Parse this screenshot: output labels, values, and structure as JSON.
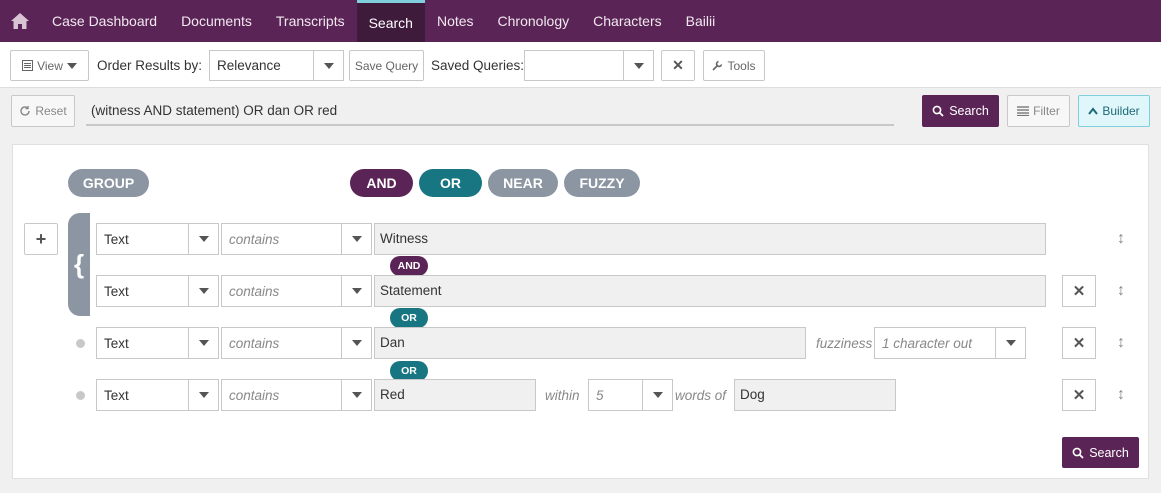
{
  "nav": {
    "home_icon": "home-icon",
    "items": [
      {
        "label": "Case Dashboard"
      },
      {
        "label": "Documents"
      },
      {
        "label": "Transcripts"
      },
      {
        "label": "Search",
        "active": true
      },
      {
        "label": "Notes"
      },
      {
        "label": "Chronology"
      },
      {
        "label": "Characters"
      },
      {
        "label": "Bailii"
      }
    ]
  },
  "toolbar": {
    "view_label": "View",
    "order_label": "Order Results by:",
    "order_value": "Relevance",
    "save_query_label": "Save Query",
    "saved_queries_label": "Saved Queries:",
    "saved_queries_value": "",
    "tools_label": "Tools"
  },
  "search": {
    "reset_label": "Reset",
    "query": "(witness AND statement) OR dan OR red",
    "search_label": "Search",
    "filter_label": "Filter",
    "builder_label": "Builder"
  },
  "builder": {
    "group_label": "GROUP",
    "operators": [
      "AND",
      "OR",
      "NEAR",
      "FUZZY"
    ],
    "group_bracket": "{",
    "rows": [
      {
        "field": "Text",
        "condition": "contains",
        "value": "Witness"
      },
      {
        "field": "Text",
        "condition": "contains",
        "value": "Statement",
        "joiner_before": "AND"
      },
      {
        "field": "Text",
        "condition": "contains",
        "value": "Dan",
        "joiner_before": "OR",
        "fuzziness_label": "fuzziness",
        "fuzziness_value": "1 character out"
      },
      {
        "field": "Text",
        "condition": "contains",
        "value": "Red",
        "joiner_before": "OR",
        "within_label": "within",
        "within_value": "5",
        "words_of_label": "words of",
        "near_value": "Dog"
      }
    ],
    "search_label": "Search",
    "add_label": "+",
    "remove_label": "✕",
    "move_label": "↕"
  },
  "colors": {
    "brand": "#5b2456",
    "accent_teal": "#187682",
    "pill_grey": "#8c96a2",
    "active_tab_border": "#7fd0dc"
  }
}
